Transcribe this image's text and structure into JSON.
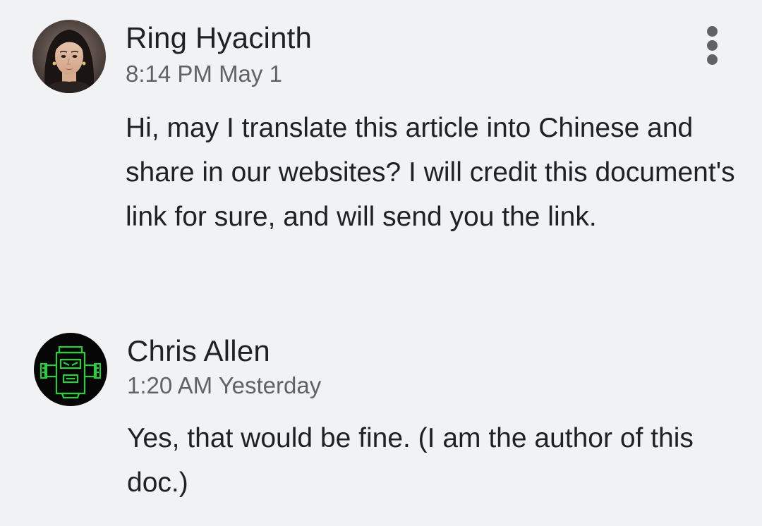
{
  "comments": [
    {
      "author": "Ring Hyacinth",
      "timestamp": "8:14 PM May 1",
      "text": "Hi, may I translate this article into Chinese and share in our websites? I will credit this document's link for sure, and will send you the link.",
      "avatar": "portrait-photo"
    },
    {
      "author": "Chris Allen",
      "timestamp": "1:20 AM Yesterday",
      "text": "Yes, that would be fine. (I am the author of this doc.)",
      "avatar": "green-robot-icon"
    }
  ],
  "menu": {
    "icon": "more-vert-icon"
  },
  "colors": {
    "background": "#f1f2f4",
    "text": "#202124",
    "secondary_text": "#5f6368",
    "robot_green": "#2ecc40"
  }
}
